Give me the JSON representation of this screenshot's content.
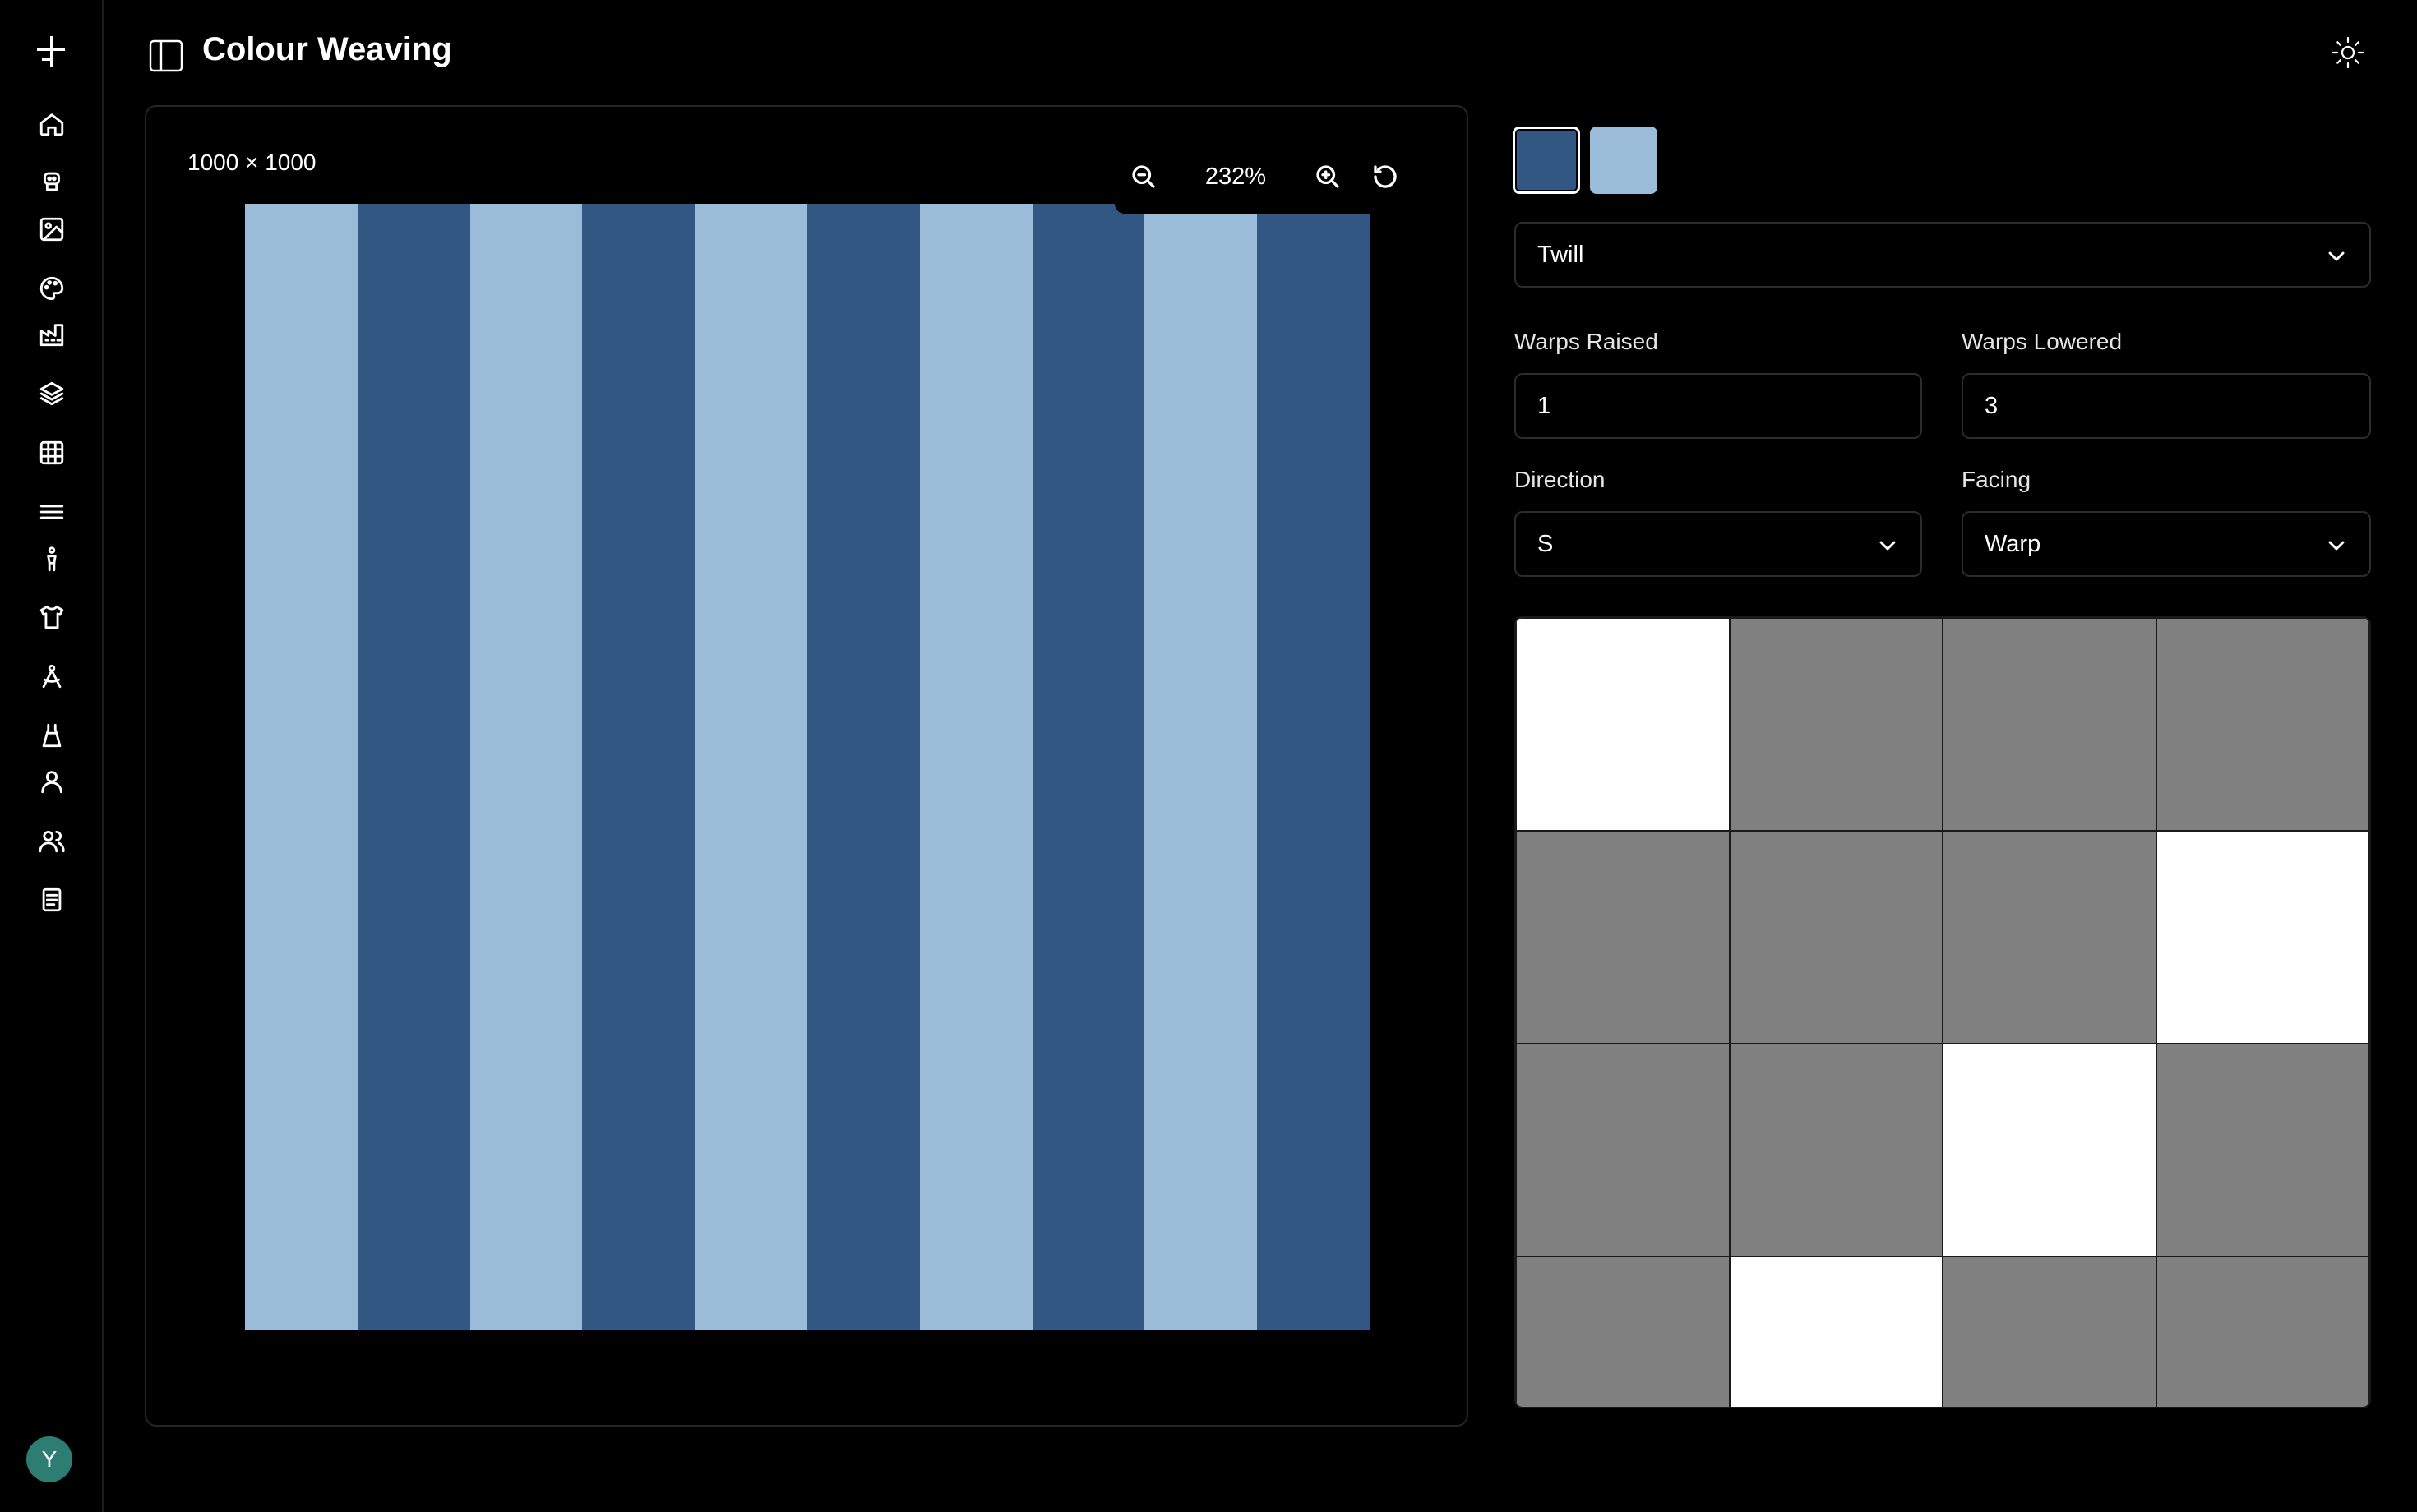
{
  "app": {
    "title": "Colour Weaving"
  },
  "sidebar": {
    "items": [
      {
        "icon": "home-icon"
      },
      {
        "icon": "robot-icon"
      },
      {
        "icon": "image-icon"
      },
      {
        "icon": "palette-icon"
      },
      {
        "icon": "factory-icon"
      },
      {
        "icon": "layers-icon"
      },
      {
        "icon": "grid-icon"
      },
      {
        "icon": "menu-lines-icon"
      },
      {
        "icon": "figure-icon"
      },
      {
        "icon": "shirt-icon"
      },
      {
        "icon": "compass-icon"
      },
      {
        "icon": "dress-icon"
      },
      {
        "icon": "user-icon"
      },
      {
        "icon": "users-icon"
      },
      {
        "icon": "document-icon"
      }
    ],
    "avatar_initial": "Y"
  },
  "canvas": {
    "dimensions": "1000 × 1000",
    "zoom": "232%",
    "stripes": [
      "#9abcd9",
      "#325782",
      "#9abcd9",
      "#325782",
      "#9abcd9",
      "#325782",
      "#9abcd9",
      "#325782",
      "#9abcd9",
      "#325782"
    ]
  },
  "colors": {
    "swatches": [
      "#325782",
      "#9abcd9"
    ],
    "selected_index": 0
  },
  "weave": {
    "pattern": "Twill",
    "warps_raised_label": "Warps Raised",
    "warps_raised": "1",
    "warps_lowered_label": "Warps Lowered",
    "warps_lowered": "3",
    "direction_label": "Direction",
    "direction": "S",
    "facing_label": "Facing",
    "facing": "Warp",
    "grid": [
      [
        1,
        0,
        0,
        0
      ],
      [
        0,
        0,
        0,
        1
      ],
      [
        0,
        0,
        1,
        0
      ],
      [
        0,
        1,
        0,
        0
      ]
    ],
    "raised_color": "#ffffff",
    "lowered_color": "#808080"
  }
}
